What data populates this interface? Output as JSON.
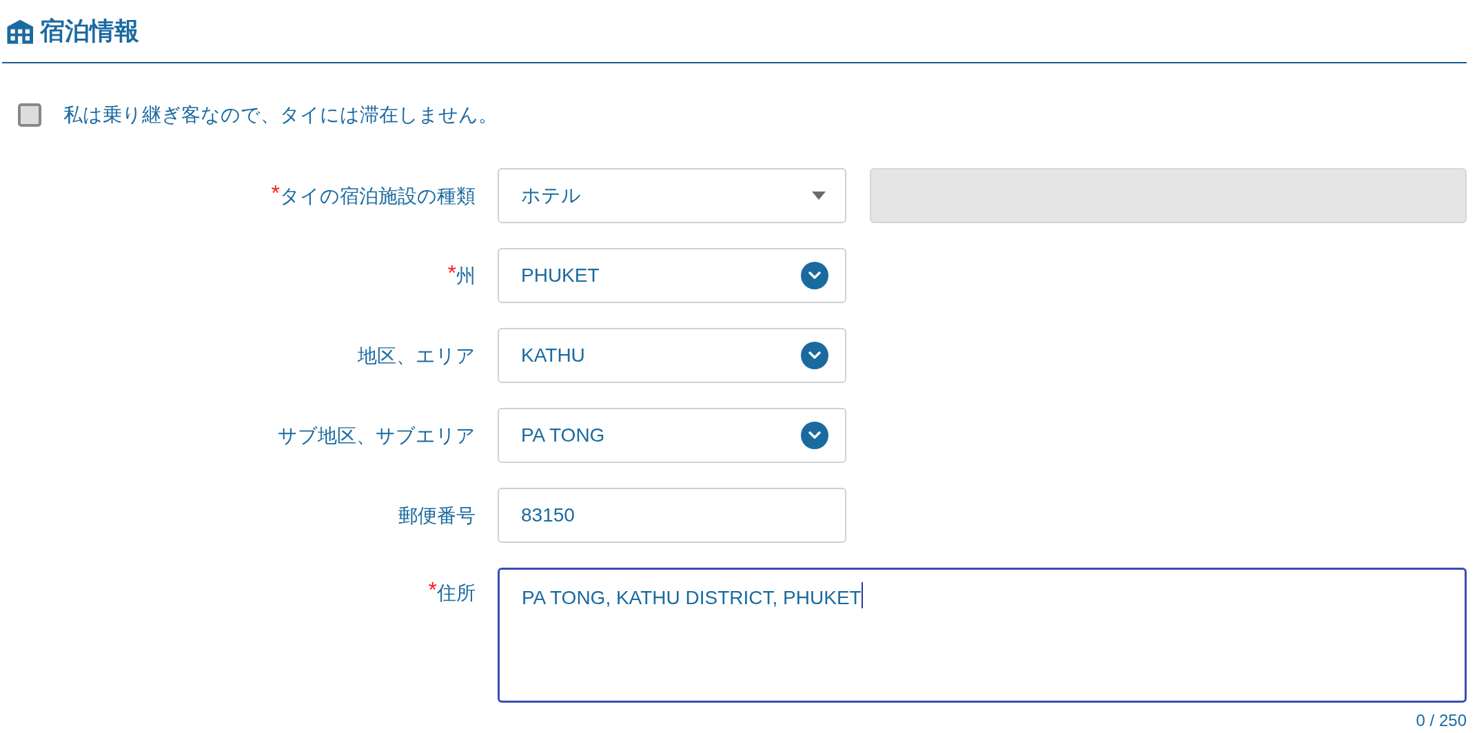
{
  "section": {
    "title": "宿泊情報"
  },
  "checkbox": {
    "label": "私は乗り継ぎ客なので、タイには滞在しません。",
    "checked": false
  },
  "fields": [
    {
      "kind": "dropdown",
      "required_mark": "*",
      "label": "タイの宿泊施設の種類",
      "value": "ホテル",
      "extra_field": {
        "disabled": true
      }
    },
    {
      "kind": "select",
      "required_mark": "*",
      "label": "州",
      "value": "PHUKET"
    },
    {
      "kind": "select",
      "label": "地区、エリア",
      "value": "KATHU"
    },
    {
      "kind": "select",
      "label": "サブ地区、サブエリア",
      "value": "PA TONG"
    },
    {
      "kind": "text",
      "label": "郵便番号",
      "value": "83150"
    },
    {
      "kind": "textarea",
      "required_mark": "*",
      "label": "住所",
      "value": "PA TONG, KATHU DISTRICT, PHUKET",
      "focused": true,
      "counter": "0 / 250"
    }
  ]
}
